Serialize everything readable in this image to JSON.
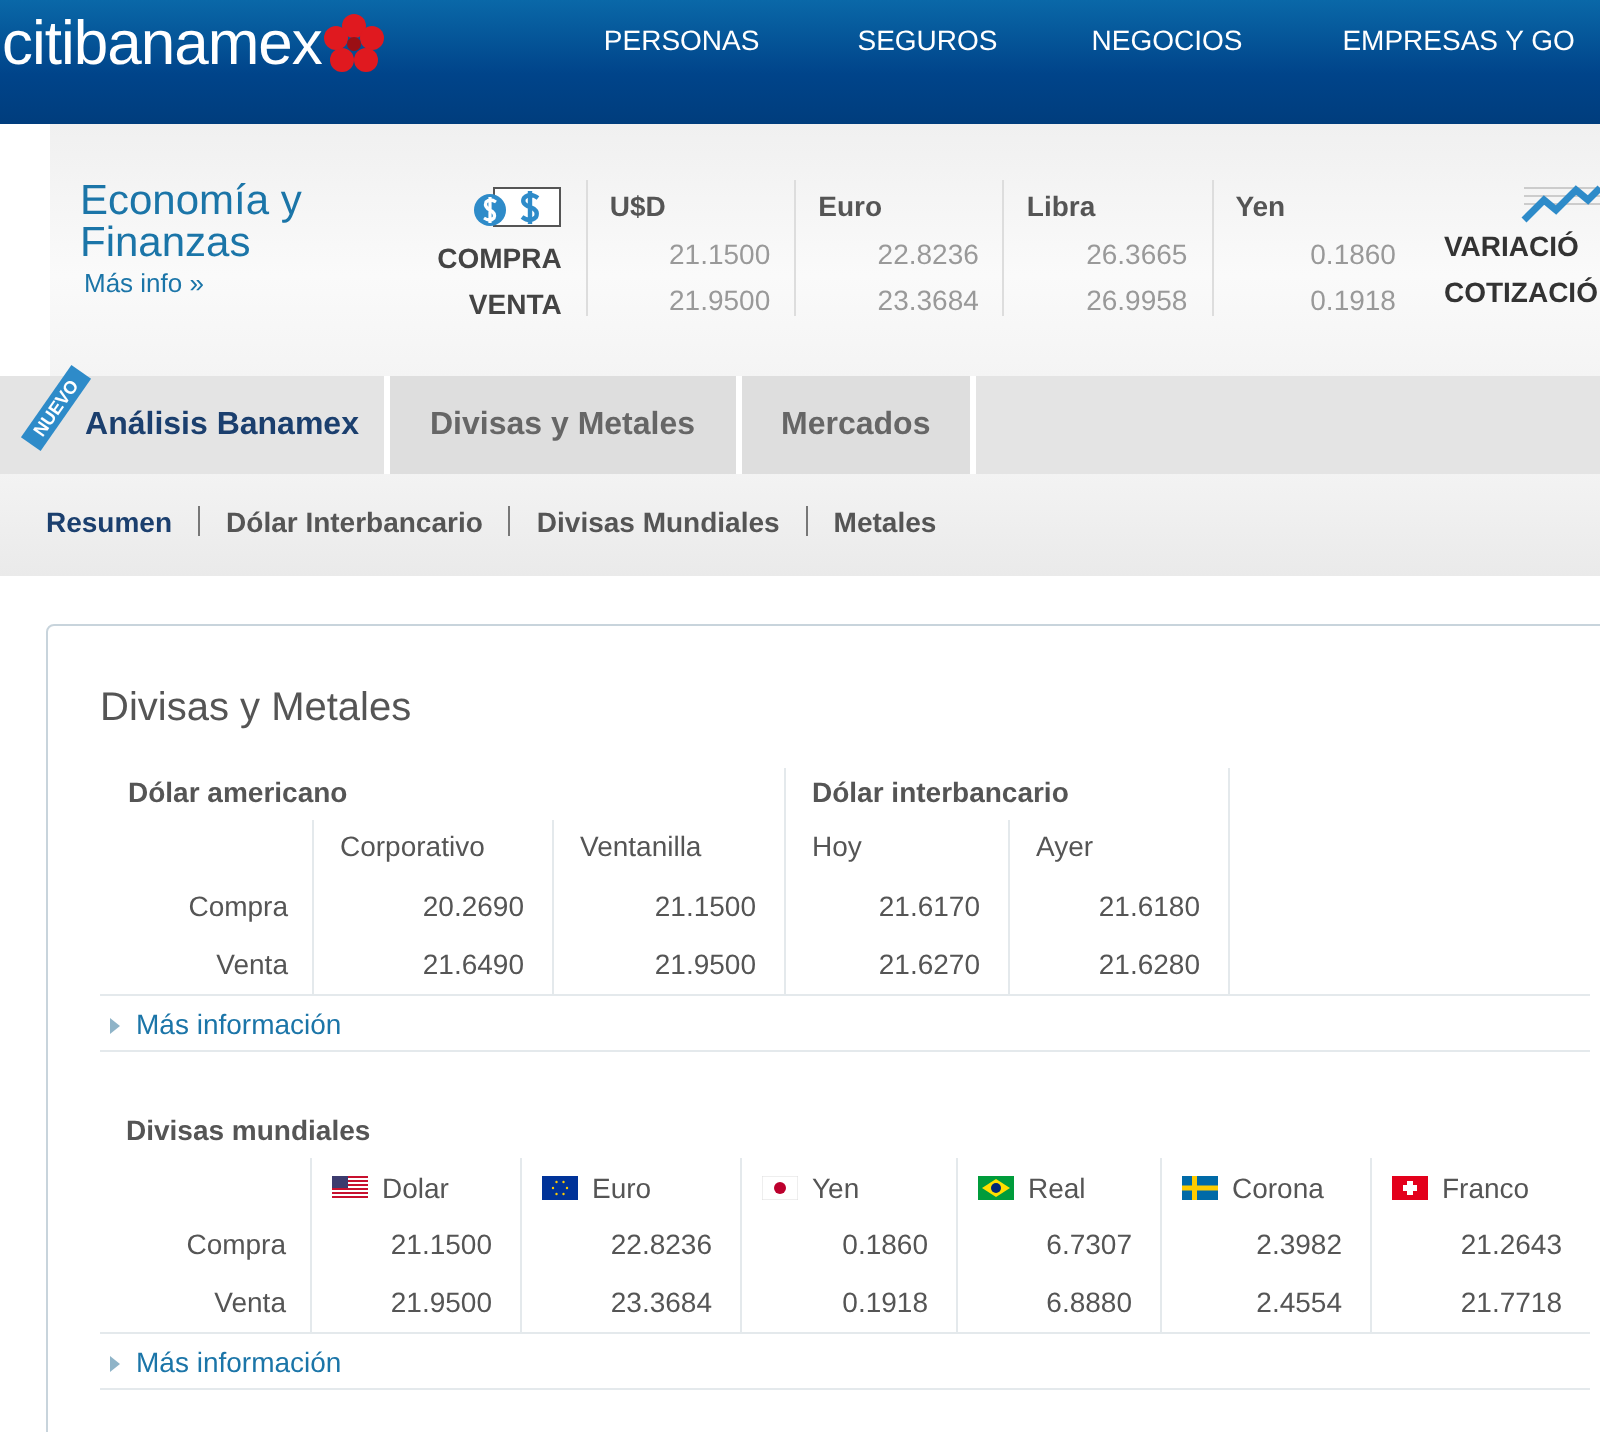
{
  "header": {
    "logo": "citibanamex",
    "nav": [
      "PERSONAS",
      "SEGUROS",
      "NEGOCIOS",
      "EMPRESAS Y GO"
    ]
  },
  "rates": {
    "title": "Economía y Finanzas",
    "more": "Más info »",
    "buy_label": "COMPRA",
    "sell_label": "VENTA",
    "currencies": [
      {
        "name": "U$D",
        "buy": "21.1500",
        "sell": "21.9500"
      },
      {
        "name": "Euro",
        "buy": "22.8236",
        "sell": "23.3684"
      },
      {
        "name": "Libra",
        "buy": "26.3665",
        "sell": "26.9958"
      },
      {
        "name": "Yen",
        "buy": "0.1860",
        "sell": "0.1918"
      }
    ],
    "links": [
      "VARIACIÓ",
      "COTIZACIÓ"
    ]
  },
  "tabs": [
    {
      "label": "Análisis Banamex",
      "selected": true,
      "badge": "NUEVO"
    },
    {
      "label": "Divisas y Metales",
      "selected": false
    },
    {
      "label": "Mercados",
      "selected": false
    }
  ],
  "subtabs": [
    {
      "label": "Resumen",
      "selected": true
    },
    {
      "label": "Dólar Interbancario",
      "selected": false
    },
    {
      "label": "Divisas Mundiales",
      "selected": false
    },
    {
      "label": "Metales",
      "selected": false
    }
  ],
  "panel": {
    "title": "Divisas y Metales",
    "dollar_table": {
      "groups": [
        {
          "title": "Dólar americano",
          "columns": [
            "Corporativo",
            "Ventanilla"
          ]
        },
        {
          "title": "Dólar interbancario",
          "columns": [
            "Hoy",
            "Ayer"
          ]
        }
      ],
      "rows": [
        {
          "label": "Compra",
          "values": [
            "20.2690",
            "21.1500",
            "21.6170",
            "21.6180"
          ]
        },
        {
          "label": "Venta",
          "values": [
            "21.6490",
            "21.9500",
            "21.6270",
            "21.6280"
          ]
        }
      ],
      "more": "Más información"
    },
    "world_table": {
      "title": "Divisas mundiales",
      "columns": [
        "Dolar",
        "Euro",
        "Yen",
        "Real",
        "Corona",
        "Franco"
      ],
      "rows": [
        {
          "label": "Compra",
          "values": [
            "21.1500",
            "22.8236",
            "0.1860",
            "6.7307",
            "2.3982",
            "21.2643"
          ]
        },
        {
          "label": "Venta",
          "values": [
            "21.9500",
            "23.3684",
            "0.1918",
            "6.8880",
            "2.4554",
            "21.7718"
          ]
        }
      ],
      "more": "Más información"
    }
  }
}
